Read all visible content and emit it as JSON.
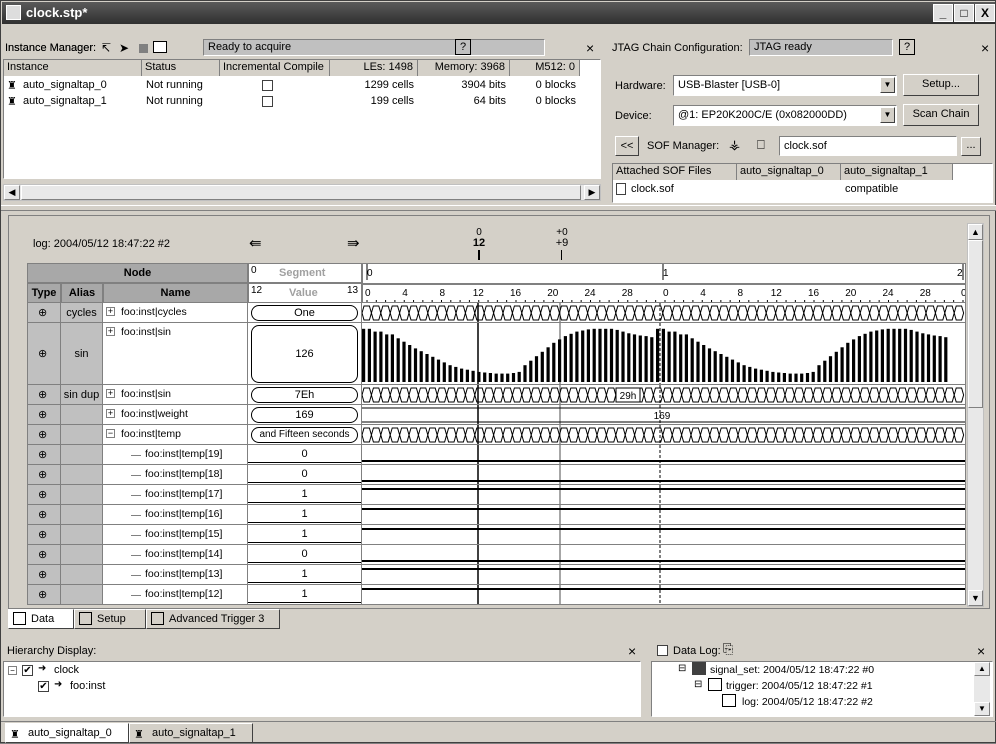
{
  "window": {
    "title": "clock.stp*",
    "btn_min": "_",
    "btn_max": "□",
    "btn_close": "X"
  },
  "instance_manager": {
    "label": "Instance Manager:",
    "status": "Ready to acquire",
    "help": "?",
    "close": "×",
    "columns": [
      "Instance",
      "Status",
      "Incremental Compile",
      "LEs: 1498",
      "Memory: 3968",
      "M512: 0"
    ],
    "rows": [
      {
        "instance": "auto_signaltap_0",
        "status": "Not running",
        "les": "1299 cells",
        "memory": "3904 bits",
        "m512": "0 blocks"
      },
      {
        "instance": "auto_signaltap_1",
        "status": "Not running",
        "les": "199 cells",
        "memory": "64 bits",
        "m512": "0 blocks"
      }
    ]
  },
  "jtag": {
    "label": "JTAG Chain Configuration:",
    "status": "JTAG ready",
    "help": "?",
    "close": "×",
    "hardware_label": "Hardware:",
    "hardware_value": "USB-Blaster [USB-0]",
    "setup_button": "Setup...",
    "device_label": "Device:",
    "device_value": "@1: EP20K200C/E (0x082000DD)",
    "scan_button": "Scan Chain",
    "sof_prev": "<<",
    "sof_label": "SOF Manager:",
    "sof_file": "clock.sof",
    "sof_browse": "...",
    "attached_columns": [
      "Attached SOF Files",
      "auto_signaltap_0",
      "auto_signaltap_1"
    ],
    "attached_rows": [
      {
        "file": "clock.sof",
        "tap0": "",
        "tap1": "compatible"
      }
    ]
  },
  "waveform": {
    "log_label": "log: 2004/05/12 18:47:22 #2",
    "marker_top": "0",
    "marker_value": "12",
    "marker2_top": "+0",
    "marker2_value": "+9",
    "node_header": "Node",
    "segment_label": "Segment",
    "segment_num": "0",
    "value_label": "Value",
    "value_left": "12",
    "value_right": "13",
    "type_header": "Type",
    "alias_header": "Alias",
    "name_header": "Name",
    "seg_ticks": [
      "0",
      "1",
      "2"
    ],
    "time_ticks": [
      "0",
      "4",
      "8",
      "12",
      "16",
      "20",
      "24",
      "28",
      "0",
      "4",
      "8",
      "12",
      "16",
      "20",
      "24",
      "28",
      "0"
    ],
    "rows": [
      {
        "alias": "cycles",
        "expand": "+",
        "name": "foo:inst|cycles",
        "value": "One"
      },
      {
        "alias": "sin",
        "expand": "+",
        "name": "foo:inst|sin",
        "value": "126"
      },
      {
        "alias": "sin dup",
        "expand": "+",
        "name": "foo:inst|sin",
        "value": "7Eh"
      },
      {
        "alias": "",
        "expand": "+",
        "name": "foo:inst|weight",
        "value": "169"
      },
      {
        "alias": "",
        "expand": "−",
        "name": "foo:inst|temp",
        "value": "and Fifteen seconds"
      },
      {
        "alias": "",
        "expand": "",
        "name": "foo:inst|temp[19]",
        "value": "0"
      },
      {
        "alias": "",
        "expand": "",
        "name": "foo:inst|temp[18]",
        "value": "0"
      },
      {
        "alias": "",
        "expand": "",
        "name": "foo:inst|temp[17]",
        "value": "1"
      },
      {
        "alias": "",
        "expand": "",
        "name": "foo:inst|temp[16]",
        "value": "1"
      },
      {
        "alias": "",
        "expand": "",
        "name": "foo:inst|temp[15]",
        "value": "1"
      },
      {
        "alias": "",
        "expand": "",
        "name": "foo:inst|temp[14]",
        "value": "0"
      },
      {
        "alias": "",
        "expand": "",
        "name": "foo:inst|temp[13]",
        "value": "1"
      },
      {
        "alias": "",
        "expand": "",
        "name": "foo:inst|temp[12]",
        "value": "1"
      }
    ],
    "bus_label_sin_dup": "29h",
    "bus_label_weight": "169",
    "sin_levels": [
      0.95,
      0.95,
      0.9,
      0.9,
      0.85,
      0.85,
      0.78,
      0.72,
      0.66,
      0.6,
      0.55,
      0.5,
      0.45,
      0.4,
      0.35,
      0.3,
      0.27,
      0.24,
      0.22,
      0.2,
      0.18,
      0.17,
      0.16,
      0.15,
      0.15,
      0.15,
      0.16,
      0.18,
      0.3,
      0.38,
      0.46,
      0.54,
      0.62,
      0.7,
      0.76,
      0.82,
      0.86,
      0.9,
      0.92,
      0.94,
      0.95,
      0.95,
      0.95,
      0.95,
      0.93,
      0.9,
      0.87,
      0.85,
      0.83,
      0.82,
      0.8
    ],
    "temp_levels": [
      0,
      0,
      1,
      1,
      1,
      0,
      1,
      1
    ]
  },
  "bottom_tabs": [
    "Data",
    "Setup",
    "Advanced Trigger 3"
  ],
  "hierarchy": {
    "title": "Hierarchy Display:",
    "close": "×",
    "items": [
      "clock",
      "foo:inst"
    ]
  },
  "datalog": {
    "title": "Data Log:",
    "close": "×",
    "items": [
      "signal_set: 2004/05/12 18:47:22  #0",
      "trigger: 2004/05/12 18:47:22  #1",
      "log: 2004/05/12 18:47:22  #2"
    ]
  },
  "instance_tabs": [
    "auto_signaltap_0",
    "auto_signaltap_1"
  ]
}
